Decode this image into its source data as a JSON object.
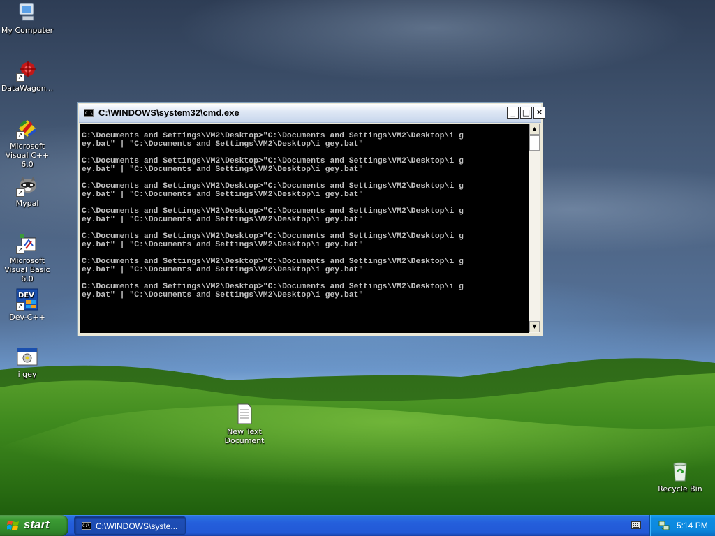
{
  "desktop": {
    "icons": [
      {
        "label": "My Computer"
      },
      {
        "label": "DataWagon..."
      },
      {
        "label": "Microsoft Visual C++ 6.0"
      },
      {
        "label": "Mypal"
      },
      {
        "label": "Microsoft Visual Basic 6.0"
      },
      {
        "label": "Dev-C++"
      },
      {
        "label": "i gey"
      },
      {
        "label": "New Text Document"
      },
      {
        "label": "Recycle Bin"
      }
    ]
  },
  "cmd_window": {
    "title": "C:\\WINDOWS\\system32\\cmd.exe",
    "icon_text": "C:\\",
    "buttons": {
      "minimize": "_",
      "maximize": "□",
      "close": "✕"
    },
    "lines": [
      "C:\\Documents and Settings\\VM2\\Desktop>\"C:\\Documents and Settings\\VM2\\Desktop\\i g",
      "ey.bat\" | \"C:\\Documents and Settings\\VM2\\Desktop\\i gey.bat\"",
      "C:\\Documents and Settings\\VM2\\Desktop>\"C:\\Documents and Settings\\VM2\\Desktop\\i g",
      "ey.bat\" | \"C:\\Documents and Settings\\VM2\\Desktop\\i gey.bat\"",
      "C:\\Documents and Settings\\VM2\\Desktop>\"C:\\Documents and Settings\\VM2\\Desktop\\i g",
      "ey.bat\" | \"C:\\Documents and Settings\\VM2\\Desktop\\i gey.bat\"",
      "C:\\Documents and Settings\\VM2\\Desktop>\"C:\\Documents and Settings\\VM2\\Desktop\\i g",
      "ey.bat\" | \"C:\\Documents and Settings\\VM2\\Desktop\\i gey.bat\"",
      "C:\\Documents and Settings\\VM2\\Desktop>\"C:\\Documents and Settings\\VM2\\Desktop\\i g",
      "ey.bat\" | \"C:\\Documents and Settings\\VM2\\Desktop\\i gey.bat\"",
      "C:\\Documents and Settings\\VM2\\Desktop>\"C:\\Documents and Settings\\VM2\\Desktop\\i g",
      "ey.bat\" | \"C:\\Documents and Settings\\VM2\\Desktop\\i gey.bat\"",
      "C:\\Documents and Settings\\VM2\\Desktop>\"C:\\Documents and Settings\\VM2\\Desktop\\i g",
      "ey.bat\" | \"C:\\Documents and Settings\\VM2\\Desktop\\i gey.bat\""
    ]
  },
  "taskbar": {
    "start_label": "start",
    "task_label": "C:\\WINDOWS\\syste...",
    "clock": "5:14 PM"
  },
  "colors": {
    "taskbar_blue": "#245edb",
    "start_green": "#3c9b34",
    "console_text": "#c0c0c0",
    "console_bg": "#000000"
  }
}
